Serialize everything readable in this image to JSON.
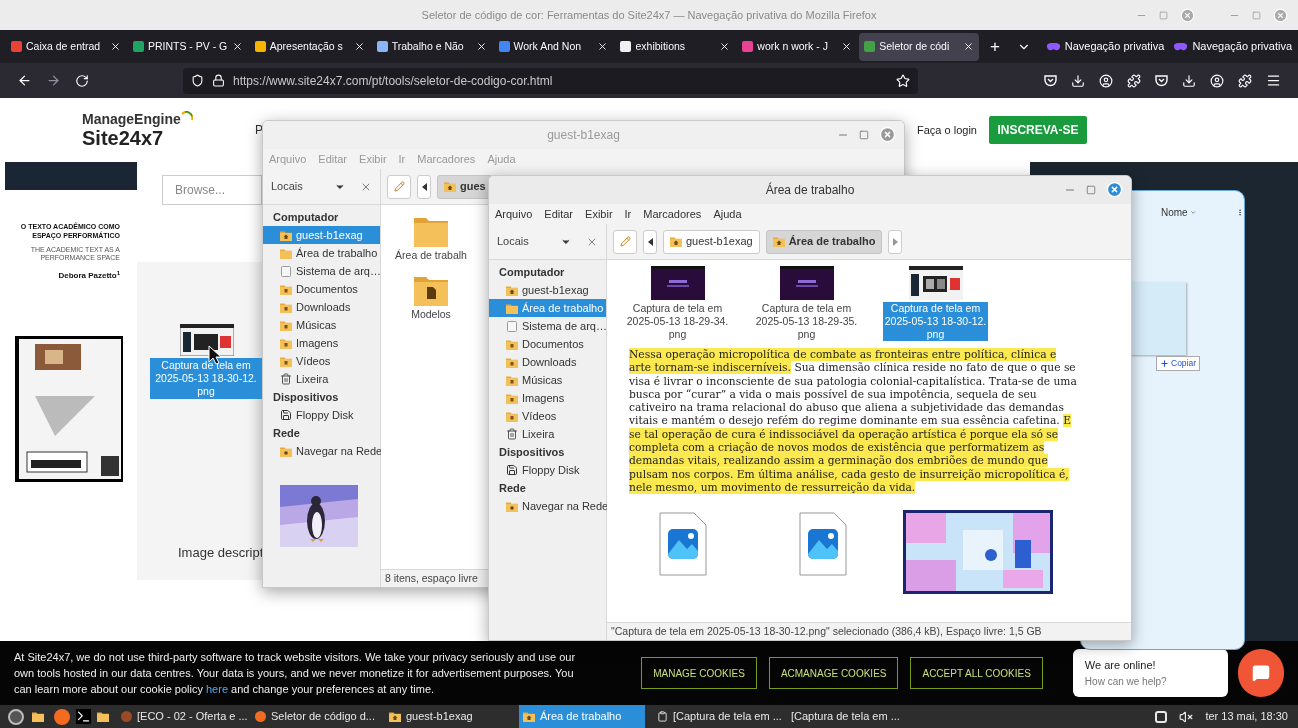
{
  "browser": {
    "title": "Seletor de código de cor: Ferramentas do Site24x7 — Navegação privativa do Mozilla Firefox",
    "tabs": [
      {
        "label": "Caixa de entrad",
        "color": "#ea4335",
        "selected": false
      },
      {
        "label": "PRINTS - PV - G",
        "color": "#1fa463",
        "selected": false
      },
      {
        "label": "Apresentação s",
        "color": "#f4b400",
        "selected": false
      },
      {
        "label": "Trabalho e Não",
        "color": "#8ab4f8",
        "selected": false
      },
      {
        "label": "Work And Non",
        "color": "#4285f4",
        "selected": false
      },
      {
        "label": "exhibitions",
        "color": "#f0f0f0",
        "selected": false
      },
      {
        "label": "work n work - J",
        "color": "#e84393",
        "selected": false
      },
      {
        "label": "Seletor de códi",
        "color": "#43a047",
        "selected": true
      }
    ],
    "new_tab": "+",
    "private_labels": [
      "Navegação privativa",
      "Navegação privativa"
    ],
    "url": "https://www.site24x7.com/pt/tools/seletor-de-codigo-cor.html"
  },
  "site": {
    "logo_top": "ManageEngine",
    "logo_bottom": "Site24x7",
    "menu_fragment": "P",
    "login": "Faça o login",
    "signup": "INSCREVA-SE",
    "browse": "Browse...",
    "article": {
      "title": "O TEXTO ACADÊMICO COMO ESPAÇO PERFORMÁTICO",
      "subtitle": "THE ACADEMIC TEXT AS A PERFORMANCE SPACE",
      "author": "Debora Pazetto$^{1}$"
    },
    "image_caption": "Image descript",
    "sort": "Nome",
    "copy": "Copiar"
  },
  "drag_item": {
    "lines": [
      "Captura de tela em",
      "2025-05-13 18-30-12.",
      "png"
    ]
  },
  "windows": [
    {
      "title": "guest-b1exag",
      "active": false,
      "menu": [
        "Arquivo",
        "Editar",
        "Exibir",
        "Ir",
        "Marcadores",
        "Ajuda"
      ],
      "places": "Locais",
      "path": [
        {
          "label": "gues",
          "selected": true
        }
      ],
      "sidebar": [
        {
          "heading": "Computador",
          "items": [
            {
              "label": "guest-b1exag",
              "selected": true
            },
            {
              "label": "Área de trabalho",
              "selected": false
            },
            {
              "label": "Sistema de arq…",
              "selected": false
            },
            {
              "label": "Documentos",
              "selected": false
            },
            {
              "label": "Downloads",
              "selected": false
            },
            {
              "label": "Músicas",
              "selected": false
            },
            {
              "label": "Imagens",
              "selected": false
            },
            {
              "label": "Vídeos",
              "selected": false
            },
            {
              "label": "Lixeira",
              "selected": false
            }
          ]
        },
        {
          "heading": "Dispositivos",
          "items": [
            {
              "label": "Floppy Disk",
              "selected": false
            }
          ]
        },
        {
          "heading": "Rede",
          "items": [
            {
              "label": "Navegar na Rede",
              "selected": false
            }
          ]
        }
      ],
      "items": [
        {
          "kind": "folder",
          "lines": [
            "Área de trabalh"
          ],
          "selected": false
        },
        {
          "kind": "template",
          "lines": [
            "Modelos"
          ],
          "selected": false
        }
      ],
      "status": "8 itens, espaço livre"
    },
    {
      "title": "Área de trabalho",
      "active": true,
      "menu": [
        "Arquivo",
        "Editar",
        "Exibir",
        "Ir",
        "Marcadores",
        "Ajuda"
      ],
      "places": "Locais",
      "path": [
        {
          "label": "guest-b1exag",
          "selected": false
        },
        {
          "label": "Área de trabalho",
          "selected": true
        }
      ],
      "sidebar": [
        {
          "heading": "Computador",
          "items": [
            {
              "label": "guest-b1exag",
              "selected": false
            },
            {
              "label": "Área de trabalho",
              "selected": true
            },
            {
              "label": "Sistema de arq…",
              "selected": false
            },
            {
              "label": "Documentos",
              "selected": false
            },
            {
              "label": "Downloads",
              "selected": false
            },
            {
              "label": "Músicas",
              "selected": false
            },
            {
              "label": "Imagens",
              "selected": false
            },
            {
              "label": "Vídeos",
              "selected": false
            },
            {
              "label": "Lixeira",
              "selected": false
            }
          ]
        },
        {
          "heading": "Dispositivos",
          "items": [
            {
              "label": "Floppy Disk",
              "selected": false
            }
          ]
        },
        {
          "heading": "Rede",
          "items": [
            {
              "label": "Navegar na Rede",
              "selected": false
            }
          ]
        }
      ],
      "items": [
        {
          "kind": "dark-screenshot",
          "lines": [
            "Captura de tela em",
            "2025-05-13 18-29-34.",
            "png"
          ],
          "selected": false
        },
        {
          "kind": "dark-screenshot",
          "lines": [
            "Captura de tela em",
            "2025-05-13 18-29-35.",
            "png"
          ],
          "selected": false
        },
        {
          "kind": "light-screenshot",
          "lines": [
            "Captura de tela em",
            "2025-05-13 18-30-12.",
            "png"
          ],
          "selected": true
        },
        {
          "kind": "document",
          "segments": [
            {
              "text": "Nessa operação micropolítica de combate as fronteiras entre política, clínica e arte tornam-se indiscerníveis.",
              "highlighted": true
            },
            {
              "text": " Sua dimensão clínica reside no fato de que o que se visa é livrar o inconsciente de sua patologia colonial-capitalística. Trata-se de uma busca por “curar” a vida o mais possível de sua impotência, sequela de seu cativeiro na trama relacional do abuso que aliena a subjetividade das demandas vitais e mantém o desejo refém do regime dominante em sua essência cafetina. ",
              "highlighted": false
            },
            {
              "text": "E se tal operação de cura é indissociável da operação artística é porque ela só se completa com a criação de novos modos de existência que performatizem as demandas vitais, realizando assim a germinação dos embriões de mundo que pulsam nos corpos. Em última análise, cada gesto de insurreição micropolítica é, nele mesmo, um movimento de ressurreição da vida.",
              "highlighted": true
            }
          ]
        },
        {
          "kind": "image-file"
        },
        {
          "kind": "image-file"
        },
        {
          "kind": "picture"
        }
      ],
      "status": "\"Captura de tela em 2025-05-13 18-30-12.png\" selecionado (386,4 kB), Espaço livre: 1,5 GB"
    }
  ],
  "cookie": {
    "text_before": "At Site24x7, we do not use third-party software to track website visitors. We take your privacy seriously and use our own tools hosted in our data centres. Your data is yours, and we never monetize it for advertisement purposes. You can learn more about our cookie policy ",
    "link": "here",
    "text_after": " and change your preferences at any time.",
    "buttons": [
      "MANAGE COOKIES",
      "ACMANAGE COOKIES",
      "ACCEPT ALL COOKIES"
    ]
  },
  "chat": {
    "title": "We are online!",
    "subtitle": "How can we help?"
  },
  "taskbar": {
    "items": [
      {
        "label": "[ECO - 02 - Oferta e ...",
        "selected": false
      },
      {
        "label": "Seletor de código d...",
        "selected": false
      },
      {
        "label": "guest-b1exag",
        "selected": false
      },
      {
        "label": "Área de trabalho",
        "selected": true
      },
      {
        "label": "[Captura de tela em ...",
        "selected": false
      },
      {
        "label": "[Captura de tela em ...",
        "selected": false
      }
    ],
    "clock": "ter 13 mai, 18:30"
  }
}
